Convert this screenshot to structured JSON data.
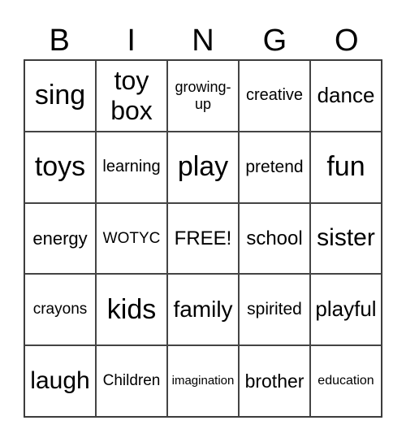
{
  "header": [
    "B",
    "I",
    "N",
    "G",
    "O"
  ],
  "cells": [
    "sing",
    "toy box",
    "growing-up",
    "creative",
    "dance",
    "toys",
    "learning",
    "play",
    "pretend",
    "fun",
    "energy",
    "WOTYC",
    "FREE!",
    "school",
    "sister",
    "crayons",
    "kids",
    "family",
    "spirited",
    "playful",
    "laugh",
    "Children",
    "imagination",
    "brother",
    "education"
  ]
}
